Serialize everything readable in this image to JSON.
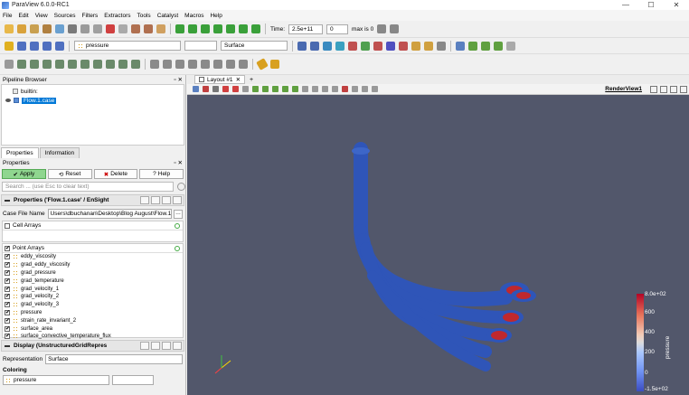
{
  "window": {
    "title": "ParaView 6.0.0-RC1",
    "controls": [
      "—",
      "☐",
      "✕"
    ]
  },
  "menu": [
    "File",
    "Edit",
    "View",
    "Sources",
    "Filters",
    "Extractors",
    "Tools",
    "Catalyst",
    "Macros",
    "Help"
  ],
  "toolbar": {
    "time_label": "Time:",
    "time_value": "2.5e+11",
    "step_value": "0",
    "max_label": "max is 0",
    "color_array": "pressure",
    "representation": "Surface"
  },
  "pipeline": {
    "header": "Pipeline Browser",
    "items": [
      {
        "label": "builtin:"
      },
      {
        "label": "Flow.1.case"
      }
    ]
  },
  "properties": {
    "tabs": [
      "Properties",
      "Information"
    ],
    "header": "Properties",
    "buttons": {
      "apply": "Apply",
      "reset": "Reset",
      "delete": "Delete",
      "help": "Help"
    },
    "search_placeholder": "Search ... (use Esc to clear text)",
    "section_props": "Properties ('Flow.1.case' / EnSight",
    "case_file_label": "Case File Name",
    "case_file_value": "Users\\dbuchanan\\Desktop\\Blog August\\Flow.1.case",
    "cell_arrays": "Cell Arrays",
    "point_arrays": "Point Arrays",
    "arrays": [
      "eddy_viscosity",
      "grad_eddy_viscosity",
      "grad_pressure",
      "grad_temperature",
      "grad_velocity_1",
      "grad_velocity_2",
      "grad_velocity_3",
      "pressure",
      "strain_rate_invariant_2",
      "surface_area",
      "surface_convective_temperature_flux"
    ],
    "section_display": "Display (UnstructuredGridRepres",
    "representation_label": "Representation",
    "representation_value": "Surface",
    "coloring_label": "Coloring",
    "coloring_value": "pressure"
  },
  "view": {
    "layout_tab": "Layout #1",
    "render_view": "RenderView1",
    "colorbar": {
      "title": "pressure",
      "ticks": [
        "8.0e+02",
        "600",
        "400",
        "200",
        "0",
        "-1.5e+02"
      ]
    }
  },
  "colors": {
    "accent": "#0078d7",
    "viewport_bg": "#52576b",
    "model": "#2f55b8",
    "apply": "#8fd68f"
  }
}
